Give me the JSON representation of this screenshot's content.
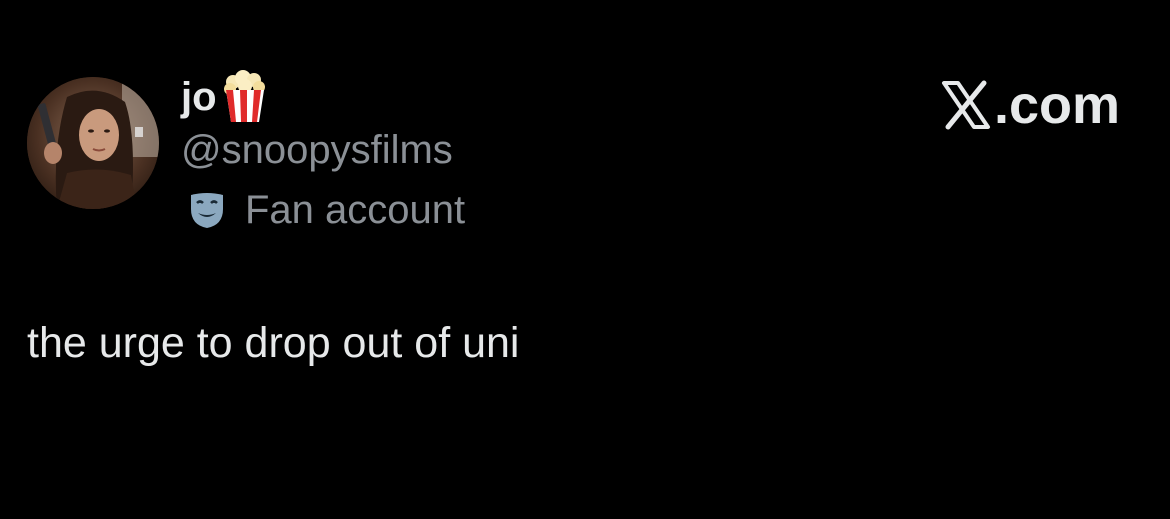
{
  "author": {
    "display_name": "jo",
    "display_name_emoji": "popcorn-icon",
    "handle": "@snoopysfilms",
    "label_icon": "performing-arts-mask-icon",
    "label": "Fan account",
    "avatar": "profile-photo"
  },
  "brand": {
    "text": ".com",
    "logo": "x-logo-icon"
  },
  "tweet": {
    "text": "the urge to drop out of uni"
  },
  "colors": {
    "background": "#000000",
    "primary_text": "#e7e9ea",
    "secondary_text": "#8b9096"
  }
}
